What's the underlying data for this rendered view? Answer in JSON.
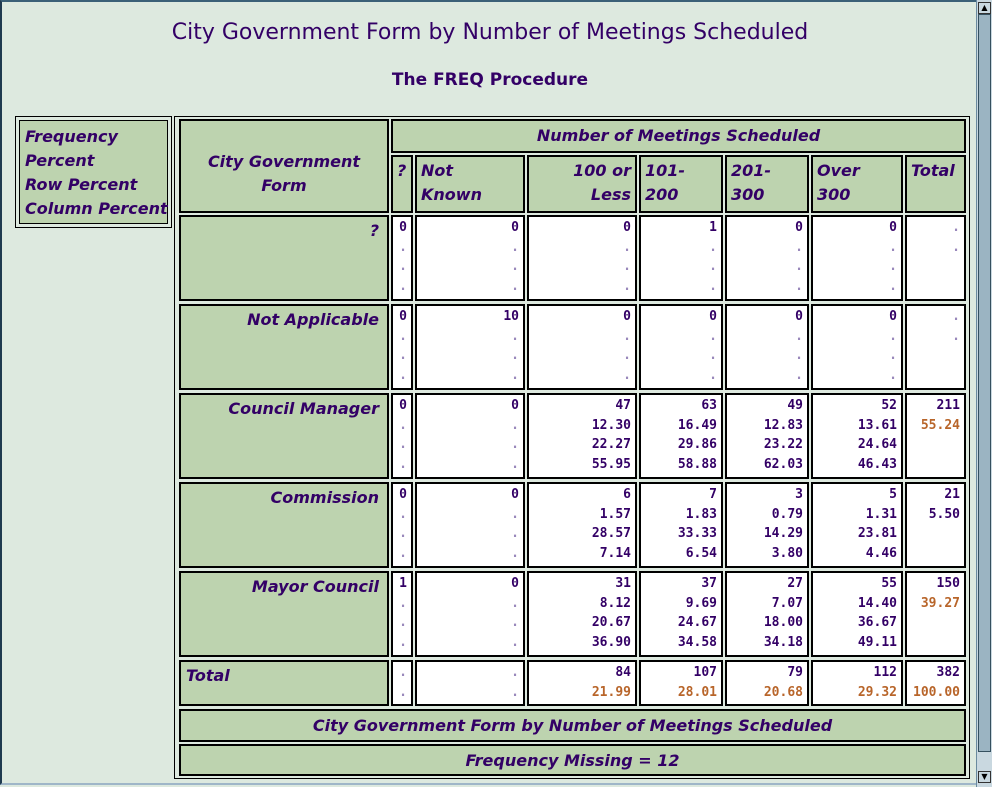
{
  "page": {
    "title": "City Government Form by Number of Meetings Scheduled",
    "subtitle": "The FREQ Procedure"
  },
  "legend": {
    "lines": [
      "Frequency",
      "Percent",
      "Row Percent",
      "Column Percent"
    ]
  },
  "table": {
    "row_var_label": "City Government Form",
    "col_var_label": "Number of Meetings Scheduled",
    "columns": [
      "?",
      "Not Known",
      "100 or Less",
      "101-200",
      "201-300",
      "Over 300",
      "Total"
    ],
    "rows": [
      {
        "label": "?",
        "cells": [
          [
            "0",
            ".",
            ".",
            "."
          ],
          [
            "0",
            ".",
            ".",
            "."
          ],
          [
            "0",
            ".",
            ".",
            "."
          ],
          [
            "1",
            ".",
            ".",
            "."
          ],
          [
            "0",
            ".",
            ".",
            "."
          ],
          [
            "0",
            ".",
            ".",
            "."
          ],
          [
            ".",
            "."
          ]
        ]
      },
      {
        "label": "Not Applicable",
        "cells": [
          [
            "0",
            ".",
            ".",
            "."
          ],
          [
            "10",
            ".",
            ".",
            "."
          ],
          [
            "0",
            ".",
            ".",
            "."
          ],
          [
            "0",
            ".",
            ".",
            "."
          ],
          [
            "0",
            ".",
            ".",
            "."
          ],
          [
            "0",
            ".",
            ".",
            "."
          ],
          [
            ".",
            "."
          ]
        ]
      },
      {
        "label": "Council Manager",
        "cells": [
          [
            "0",
            ".",
            ".",
            "."
          ],
          [
            "0",
            ".",
            ".",
            "."
          ],
          [
            "47",
            "12.30",
            "22.27",
            "55.95"
          ],
          [
            "63",
            "16.49",
            "29.86",
            "58.88"
          ],
          [
            "49",
            "12.83",
            "23.22",
            "62.03"
          ],
          [
            "52",
            "13.61",
            "24.64",
            "46.43"
          ],
          [
            "211",
            "55.24"
          ]
        ]
      },
      {
        "label": "Commission",
        "cells": [
          [
            "0",
            ".",
            ".",
            "."
          ],
          [
            "0",
            ".",
            ".",
            "."
          ],
          [
            "6",
            "1.57",
            "28.57",
            "7.14"
          ],
          [
            "7",
            "1.83",
            "33.33",
            "6.54"
          ],
          [
            "3",
            "0.79",
            "14.29",
            "3.80"
          ],
          [
            "5",
            "1.31",
            "23.81",
            "4.46"
          ],
          [
            "21",
            "5.50"
          ]
        ]
      },
      {
        "label": "Mayor Council",
        "cells": [
          [
            "1",
            ".",
            ".",
            "."
          ],
          [
            "0",
            ".",
            ".",
            "."
          ],
          [
            "31",
            "8.12",
            "20.67",
            "36.90"
          ],
          [
            "37",
            "9.69",
            "24.67",
            "34.58"
          ],
          [
            "27",
            "7.07",
            "18.00",
            "34.18"
          ],
          [
            "55",
            "14.40",
            "36.67",
            "49.11"
          ],
          [
            "150",
            "39.27"
          ]
        ]
      }
    ],
    "total_row": {
      "label": "Total",
      "cells": [
        [
          ".",
          "."
        ],
        [
          ".",
          "."
        ],
        [
          "84",
          "21.99"
        ],
        [
          "107",
          "28.01"
        ],
        [
          "79",
          "20.68"
        ],
        [
          "112",
          "29.32"
        ],
        [
          "382",
          "100.00"
        ]
      ]
    },
    "footer_title": "City Government Form by Number of Meetings Scheduled",
    "footer_missing": "Frequency Missing = 12"
  },
  "colors": {
    "header_bg": "#bdd3af",
    "page_bg": "#dde9df",
    "text": "#330066",
    "highlight_pct": "#b8652a"
  }
}
